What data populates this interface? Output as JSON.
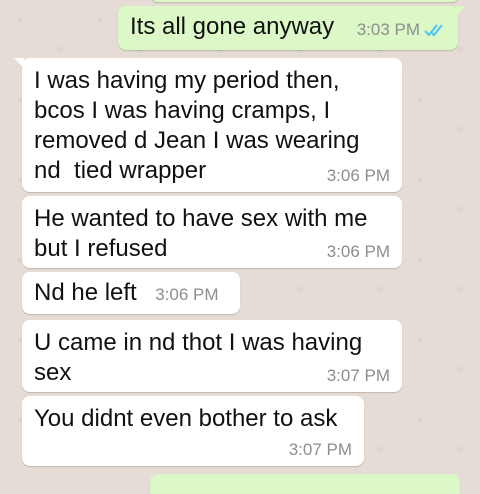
{
  "colors": {
    "outgoing_bubble": "#dcf8c6",
    "incoming_bubble": "#ffffff",
    "background": "#e5ddd5",
    "read_ticks": "#4fc3f7",
    "timestamp": "#8e8e8e"
  },
  "messages": [
    {
      "direction": "outgoing",
      "text": "Its all gone anyway",
      "time": "3:03 PM",
      "status_icon": "double-check-read-icon"
    },
    {
      "direction": "incoming",
      "text": "I was having my period then, bcos I was having cramps, I removed d Jean I was wearing nd  tied wrapper",
      "time": "3:06 PM"
    },
    {
      "direction": "incoming",
      "text": "He wanted to have sex with me but I refused",
      "time": "3:06 PM"
    },
    {
      "direction": "incoming",
      "text": "Nd he left",
      "time": "3:06 PM"
    },
    {
      "direction": "incoming",
      "text": "U came in nd thot I was having sex",
      "time": "3:07 PM"
    },
    {
      "direction": "incoming",
      "text": "You didnt even bother to ask",
      "time": "3:07 PM"
    }
  ]
}
